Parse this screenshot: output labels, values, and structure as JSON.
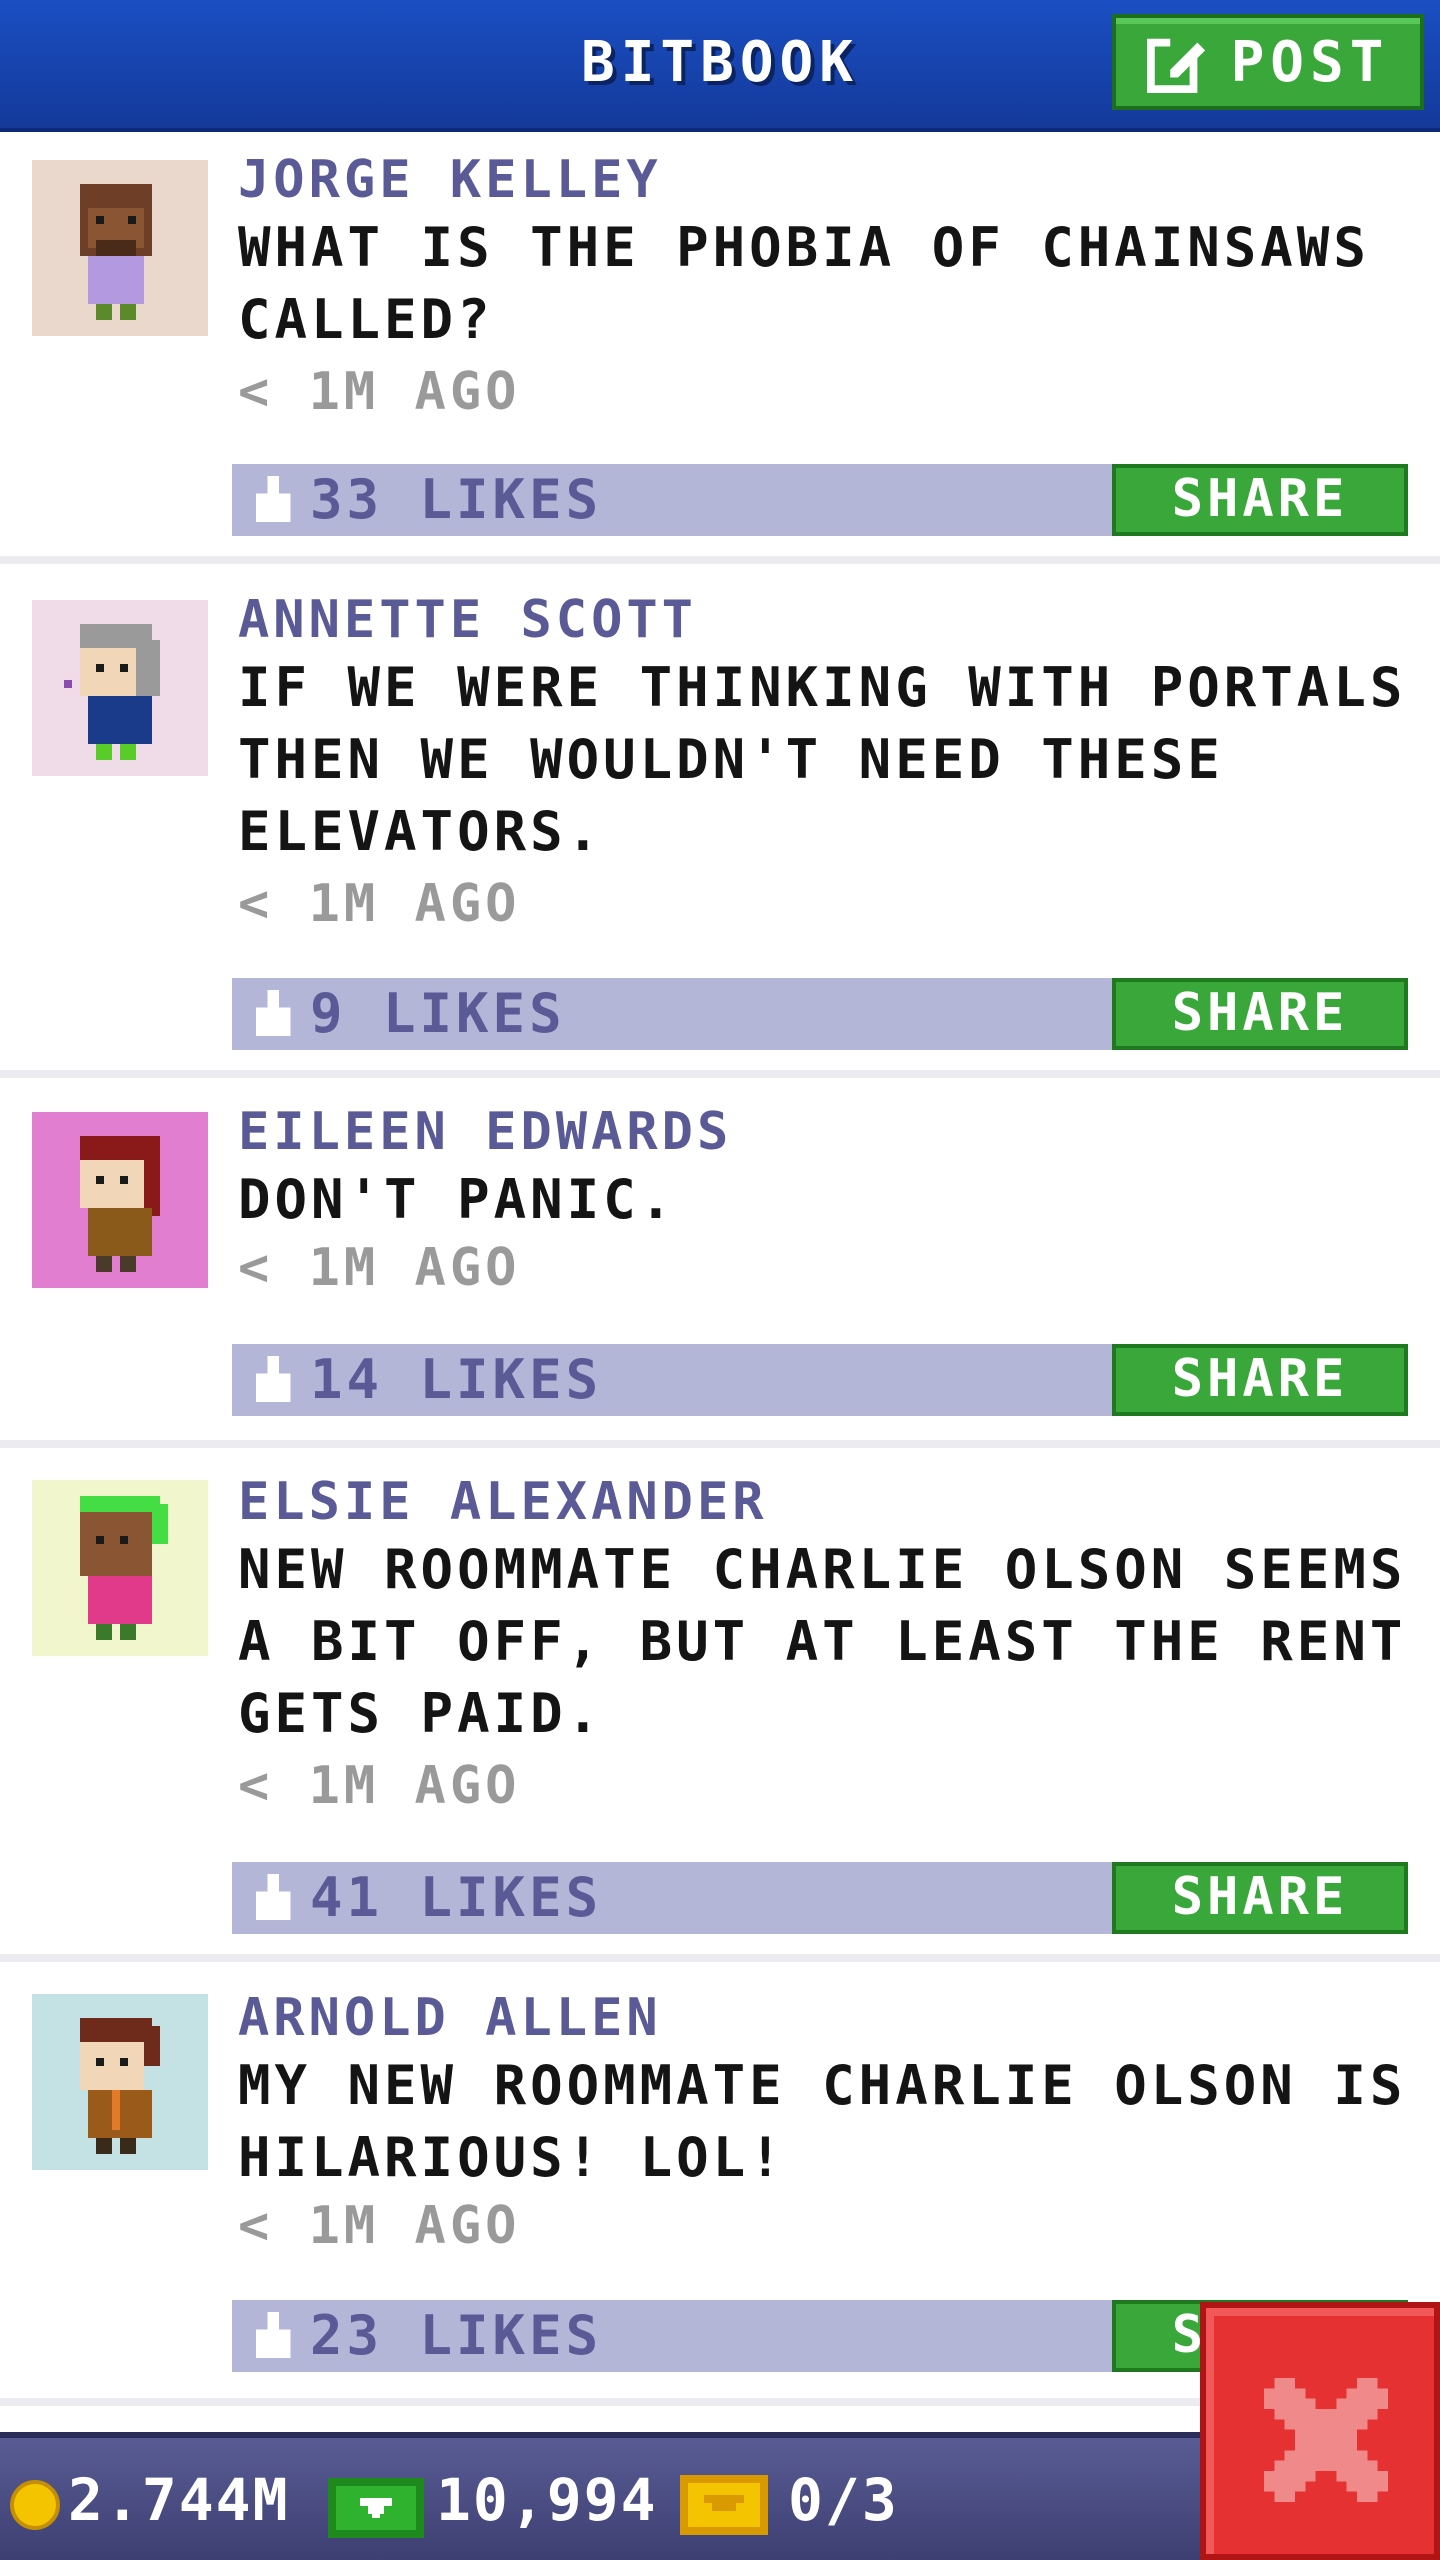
{
  "header": {
    "title": "BITBOOK",
    "post_label": "POST"
  },
  "posts": [
    {
      "name": "JORGE KELLEY",
      "text": "WHAT IS THE PHOBIA OF CHAINSAWS CALLED?",
      "time": "< 1M AGO",
      "likes": "33 LIKES",
      "share": "SHARE",
      "avatar_bg": "#ead8cc"
    },
    {
      "name": "ANNETTE SCOTT",
      "text": "IF WE WERE THINKING WITH PORTALS THEN WE WOULDN'T NEED THESE ELEVATORS.",
      "time": "< 1M AGO",
      "likes": "9 LIKES",
      "share": "SHARE",
      "avatar_bg": "#f0dce8"
    },
    {
      "name": "EILEEN EDWARDS",
      "text": "DON'T PANIC.",
      "time": "< 1M AGO",
      "likes": "14 LIKES",
      "share": "SHARE",
      "avatar_bg": "#e27ed0"
    },
    {
      "name": "ELSIE ALEXANDER",
      "text": "NEW ROOMMATE CHARLIE OLSON SEEMS A BIT OFF, BUT AT LEAST THE RENT GETS PAID.",
      "time": "< 1M AGO",
      "likes": "41 LIKES",
      "share": "SHARE",
      "avatar_bg": "#f2f6cc"
    },
    {
      "name": "ARNOLD ALLEN",
      "text": "MY NEW ROOMMATE CHARLIE OLSON IS HILARIOUS! LOL!",
      "time": "< 1M AGO",
      "likes": "23 LIKES",
      "share": "SHARE",
      "avatar_bg": "#c4e2e4"
    }
  ],
  "bottom_bar": {
    "coins": "2.744M",
    "bux": "10,994",
    "tickets": "0/3"
  },
  "colors": {
    "header_blue": "#1a4fc2",
    "share_green": "#3aa73a",
    "like_bar": "#b4b6d8",
    "name_purple": "#5a5a96",
    "close_red": "#e53131"
  }
}
